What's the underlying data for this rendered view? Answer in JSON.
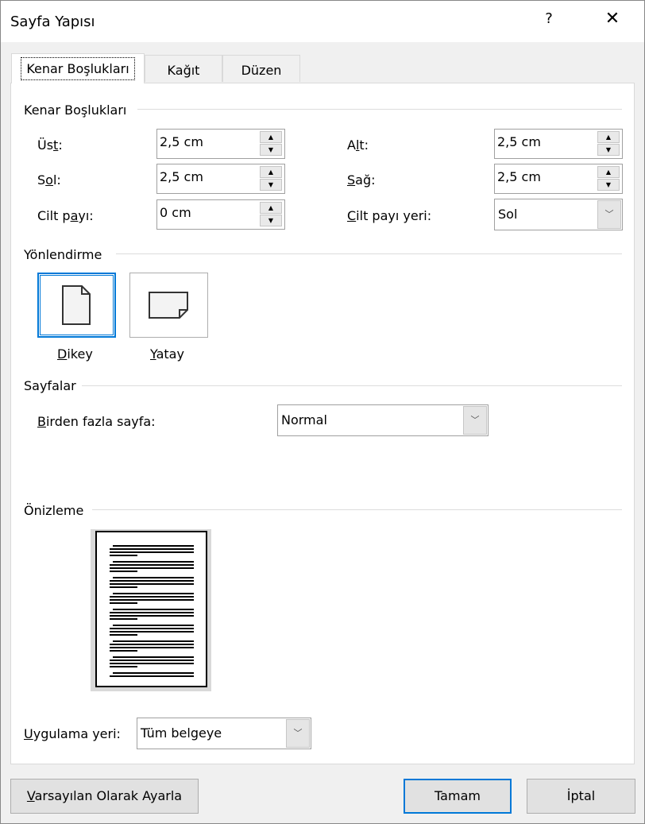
{
  "window": {
    "title": "Sayfa Yapısı",
    "help": "?",
    "close": "✕"
  },
  "tabs": [
    {
      "label": "Kenar Boşlukları",
      "active": true
    },
    {
      "label": "Kağıt"
    },
    {
      "label": "Düzen"
    }
  ],
  "margins": {
    "group": "Kenar Boşlukları",
    "top": {
      "pre": "Üs",
      "key": "t",
      "post": ":",
      "value": "2,5 cm"
    },
    "left": {
      "pre": "S",
      "key": "o",
      "post": "l:",
      "value": "2,5 cm"
    },
    "gutter": {
      "pre": "Cilt p",
      "key": "a",
      "post": "yı:",
      "value": "0 cm"
    },
    "bottom": {
      "pre": "A",
      "key": "l",
      "post": "t:",
      "value": "2,5 cm"
    },
    "right": {
      "pre": "",
      "key": "S",
      "post": "ağ:",
      "value": "2,5 cm"
    },
    "gutter_pos": {
      "pre": "",
      "key": "C",
      "post": "ilt payı yeri:",
      "value": "Sol"
    }
  },
  "orientation": {
    "group": "Yönlendirme",
    "portrait": {
      "key": "D",
      "post": "ikey",
      "selected": true
    },
    "landscape": {
      "key": "Y",
      "post": "atay"
    }
  },
  "pages": {
    "group": "Sayfalar",
    "label": {
      "key": "B",
      "post": "irden fazla sayfa:"
    },
    "value": "Normal"
  },
  "preview": {
    "group": "Önizleme"
  },
  "apply": {
    "label": {
      "key": "U",
      "post": "ygulama yeri:"
    },
    "value": "Tüm belgeye"
  },
  "buttons": {
    "default": {
      "key": "V",
      "post": "arsayılan Olarak Ayarla"
    },
    "ok": "Tamam",
    "cancel": "İptal"
  },
  "colors": {
    "accent": "#0078d7"
  }
}
